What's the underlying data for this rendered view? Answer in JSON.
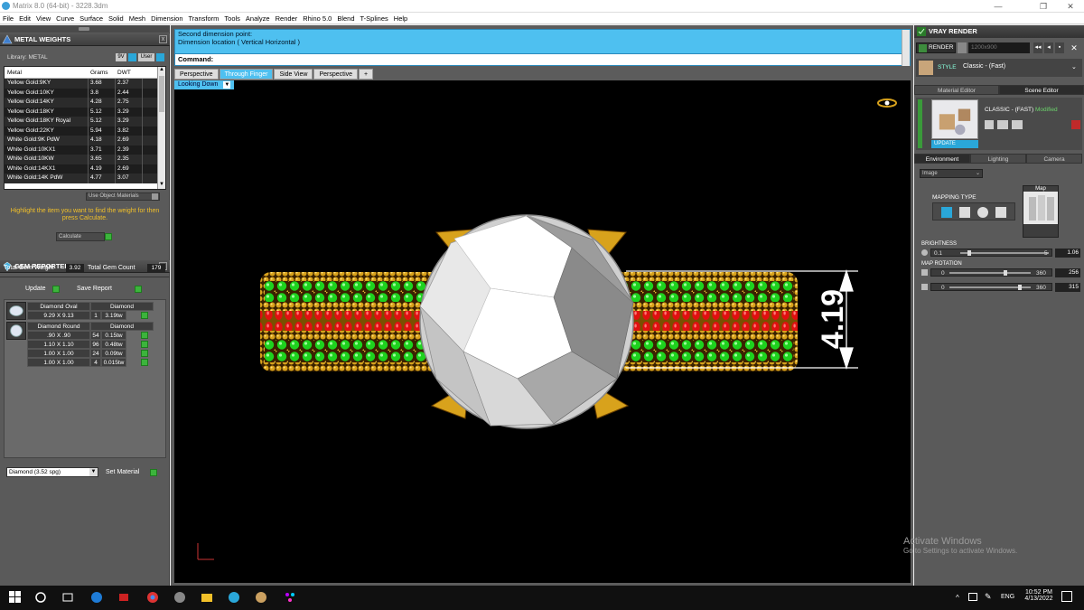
{
  "window": {
    "title": "Matrix 8.0 (64-bit) - 3228.3dm"
  },
  "menu": [
    "File",
    "Edit",
    "View",
    "Curve",
    "Surface",
    "Solid",
    "Mesh",
    "Dimension",
    "Transform",
    "Tools",
    "Analyze",
    "Render",
    "Rhino 5.0",
    "Blend",
    "T-Splines",
    "Help"
  ],
  "metal_weights": {
    "title": "METAL WEIGHTS",
    "library_label": "Library: METAL",
    "sw_label": "9V",
    "user_label": "User",
    "columns": [
      "Metal",
      "Grams",
      "DWT"
    ],
    "rows": [
      {
        "metal": "Yellow Gold:9KY",
        "grams": "3.68",
        "dwt": "2.37"
      },
      {
        "metal": "Yellow Gold:10KY",
        "grams": "3.8",
        "dwt": "2.44"
      },
      {
        "metal": "Yellow Gold:14KY",
        "grams": "4.28",
        "dwt": "2.75"
      },
      {
        "metal": "Yellow Gold:18KY",
        "grams": "5.12",
        "dwt": "3.29"
      },
      {
        "metal": "Yellow Gold:18KY Royal",
        "grams": "5.12",
        "dwt": "3.29"
      },
      {
        "metal": "Yellow Gold:22KY",
        "grams": "5.94",
        "dwt": "3.82"
      },
      {
        "metal": "White Gold:9K PdW",
        "grams": "4.18",
        "dwt": "2.69"
      },
      {
        "metal": "White Gold:10KX1",
        "grams": "3.71",
        "dwt": "2.39"
      },
      {
        "metal": "White Gold:10KW",
        "grams": "3.65",
        "dwt": "2.35"
      },
      {
        "metal": "White Gold:14KX1",
        "grams": "4.19",
        "dwt": "2.69"
      },
      {
        "metal": "White Gold:14K PdW",
        "grams": "4.77",
        "dwt": "3.07"
      }
    ],
    "use_object_materials": "Use Object Materials",
    "hint": "Highlight the item you want to find the weight for then press Calculate.",
    "calculate": "Calculate"
  },
  "gem_reporter": {
    "title": "GEM REPORTER",
    "total_weight_label": "Total Gem Weight",
    "total_weight_value": "3.92",
    "total_count_label": "Total Gem Count",
    "total_count_value": "179",
    "update": "Update",
    "save_report": "Save Report",
    "groups": [
      {
        "shape": "Diamond Oval",
        "type": "Diamond",
        "rows": [
          {
            "size": "9.29 X 9.13",
            "count": "1",
            "ct": "3.19tw"
          }
        ]
      },
      {
        "shape": "Diamond Round",
        "type": "Diamond",
        "rows": [
          {
            "size": ".90 X .90",
            "count": "54",
            "ct": "0.15tw"
          },
          {
            "size": "1.10 X 1.10",
            "count": "96",
            "ct": "0.48tw"
          },
          {
            "size": "1.00 X 1.00",
            "count": "24",
            "ct": "0.09tw"
          },
          {
            "size": "1.00 X 1.00",
            "count": "4",
            "ct": "0.015tw"
          }
        ]
      }
    ],
    "material_select": "Diamond    (3.52 spg)",
    "set_material": "Set Material"
  },
  "command": {
    "line1": "Second dimension point:",
    "line2": "Dimension location ( Vertical  Horizontal )",
    "prompt": "Command:"
  },
  "viewport_tabs": [
    "Perspective",
    "Through Finger",
    "Side View",
    "Perspective"
  ],
  "active_tab_index": 1,
  "view_mode": "Looking Down",
  "dimension_value": "4.19",
  "vray": {
    "title": "VRAY RENDER",
    "render_label": "RENDER",
    "resolution": "1200x900",
    "style_label": "STYLE",
    "style_value": "Classic - (Fast)",
    "tab_material": "Material Editor",
    "tab_scene": "Scene Editor",
    "scene_name": "CLASSIC - (FAST)",
    "scene_modified": "Modified",
    "update": "UPDATE",
    "tab_environment": "Environment",
    "tab_lighting": "Lighting",
    "tab_camera": "Camera",
    "env_select": "Image",
    "mapping_type": "MAPPING TYPE",
    "map_label": "Map",
    "brightness_label": "BRIGHTNESS",
    "brightness_min": "0.1",
    "brightness_max": "5",
    "brightness_value": "1.06",
    "map_rotation_label": "MAP ROTATION",
    "rot1_min": "0",
    "rot1_max": "360",
    "rot1_value": "256",
    "rot2_min": "0",
    "rot2_max": "360",
    "rot2_value": "315"
  },
  "watermark": {
    "line1": "Activate Windows",
    "line2": "Go to Settings to activate Windows."
  },
  "tray": {
    "lang": "ENG",
    "time": "10:52 PM",
    "date": "4/13/2022"
  },
  "colors": {
    "accent": "#4ec0f0",
    "panel": "#5a5a5a",
    "gold": "#d8a21c",
    "emerald": "#1ed21e",
    "ruby": "#e01010"
  }
}
